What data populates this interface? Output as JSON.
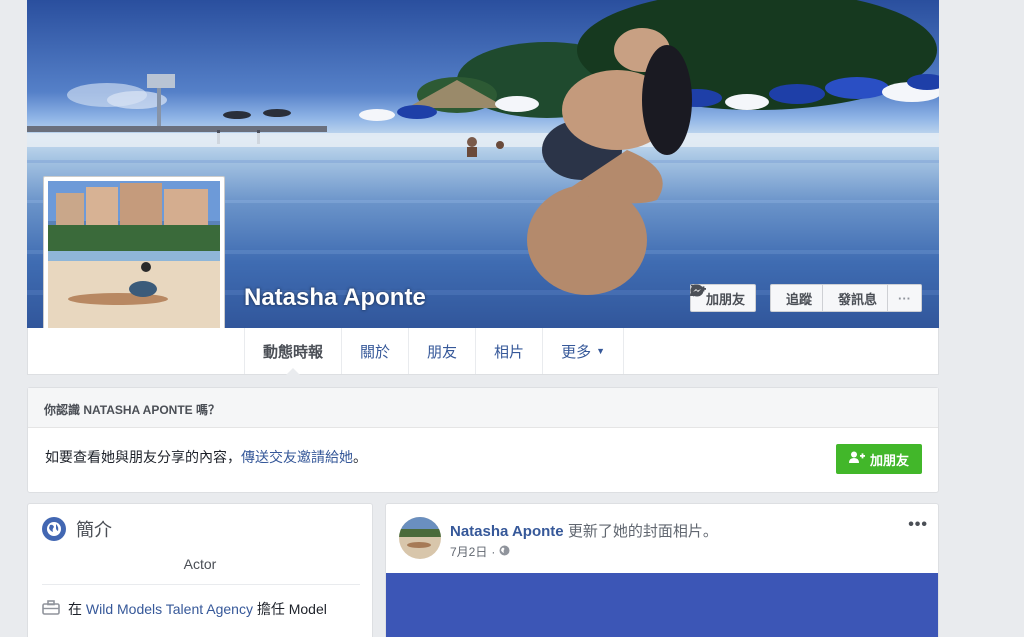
{
  "profile": {
    "name": "Natasha Aponte",
    "actions": {
      "add_friend": "加朋友",
      "follow": "追蹤",
      "message": "發訊息",
      "more": "···"
    }
  },
  "tabs": [
    {
      "label": "動態時報",
      "active": true
    },
    {
      "label": "關於"
    },
    {
      "label": "朋友"
    },
    {
      "label": "相片"
    },
    {
      "label": "更多"
    }
  ],
  "know_box": {
    "title": "你認識 NATASHA APONTE 嗎？",
    "text_prefix": "如要查看她與朋友分享的內容，",
    "link": "傳送交友邀請給她",
    "text_suffix": "。",
    "button": "加朋友"
  },
  "intro": {
    "title": "簡介",
    "occupation": "Actor",
    "work_prefix": "在",
    "work_link": "Wild Models Talent Agency",
    "work_suffix": "擔任 Model"
  },
  "post": {
    "author": "Natasha Aponte",
    "action": "更新了她的封面相片。",
    "date": "7月2日",
    "separator": "·",
    "more": "•••"
  },
  "colors": {
    "link": "#365899",
    "green_button": "#42b72a",
    "page_bg": "#e9ebee",
    "cover_water": "#4a76be"
  }
}
